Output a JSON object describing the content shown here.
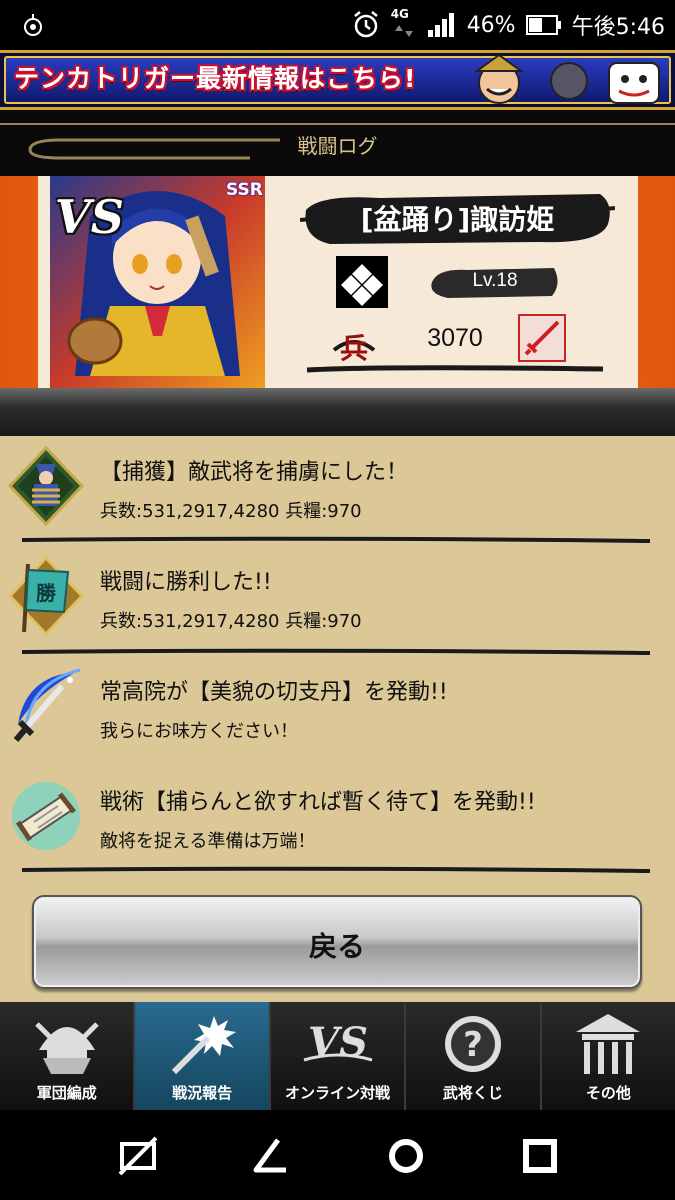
{
  "status_bar": {
    "network": "4G",
    "battery": "46%",
    "time": "午後5:46"
  },
  "banner": {
    "text": "テンカトリガー最新情報はこちら!"
  },
  "log_header": {
    "title": "戦闘ログ"
  },
  "character": {
    "rarity": "SSR",
    "vs_label": "VS",
    "name": "[盆踊り]諏訪姫",
    "level": "Lv.18",
    "troop_icon_char": "兵",
    "troops": "3070"
  },
  "log_entries": [
    {
      "icon": "captured-soldier-icon",
      "line1": "【捕獲】敵武将を捕虜にした！",
      "line2": "兵数:531,2917,4280 兵糧:970"
    },
    {
      "icon": "victory-flag-icon",
      "flag_char": "勝",
      "line1": "戦闘に勝利した!!",
      "line2": "兵数:531,2917,4280 兵糧:970"
    },
    {
      "icon": "sword-crescent-icon",
      "line1": "常高院が【美貌の切支丹】を発動!!",
      "line2": "我らにお味方ください！"
    },
    {
      "icon": "scroll-icon",
      "line1": "戦術【捕らんと欲すれば暫く待て】を発動!!",
      "line2": "敵将を捉える準備は万端！"
    }
  ],
  "back_button": "戻る",
  "game_nav": [
    {
      "label": "軍団編成",
      "icon": "helmet-icon",
      "active": false
    },
    {
      "label": "戦況報告",
      "icon": "weapon-burst-icon",
      "active": true
    },
    {
      "label": "オンライン対戦",
      "icon": "vs-icon",
      "active": false
    },
    {
      "label": "武将くじ",
      "icon": "question-icon",
      "active": false
    },
    {
      "label": "その他",
      "icon": "gate-icon",
      "active": false
    }
  ],
  "colors": {
    "accent_orange": "#f07a1a",
    "log_background": "#dbc896",
    "active_nav": "#2a6a90"
  }
}
